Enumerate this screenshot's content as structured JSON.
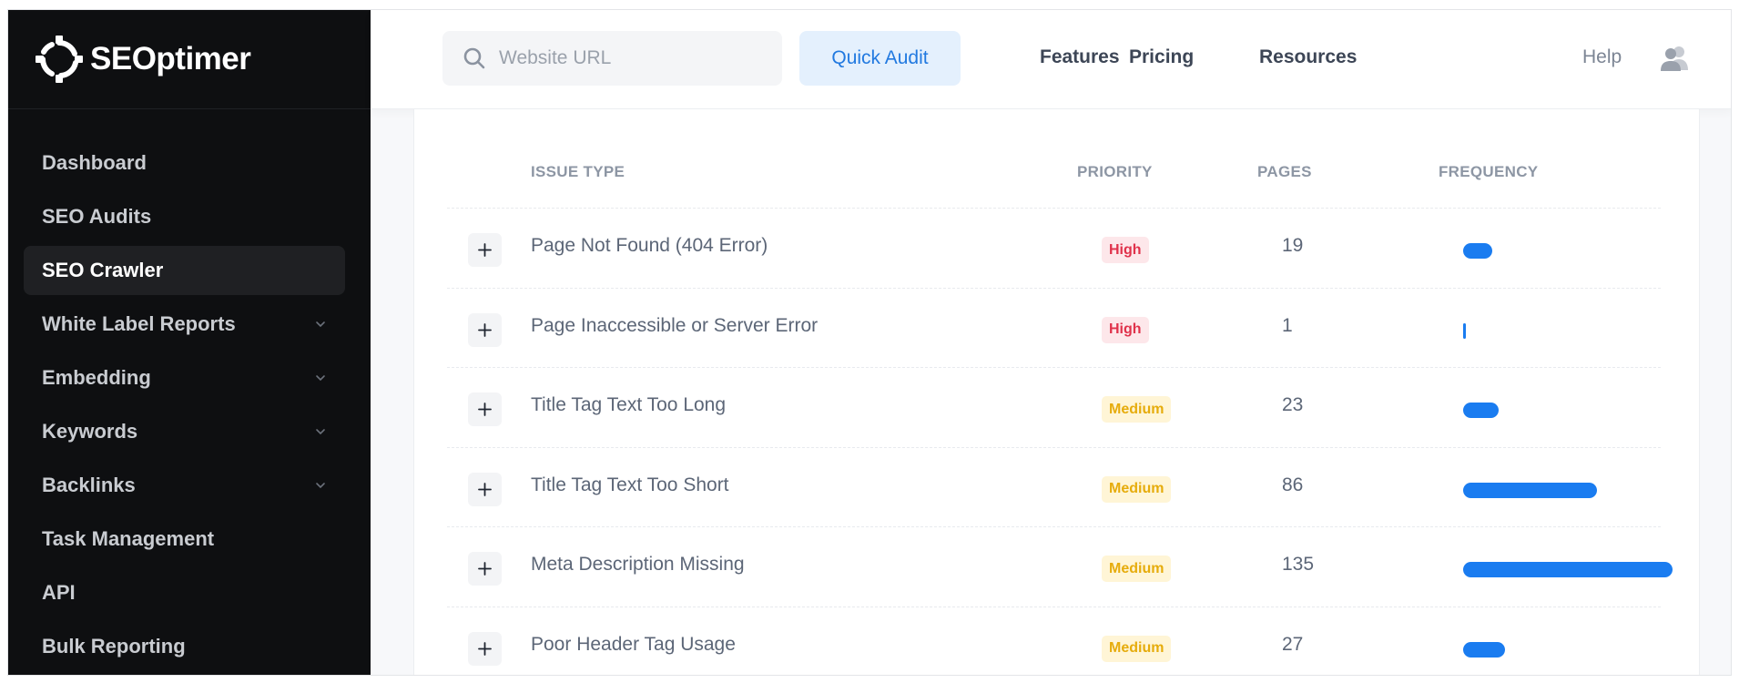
{
  "brand": {
    "name": "SEOptimer"
  },
  "sidebar": {
    "items": [
      {
        "label": "Dashboard",
        "name": "sidebar-item-dashboard",
        "active": false,
        "expandable": false
      },
      {
        "label": "SEO Audits",
        "name": "sidebar-item-seo-audits",
        "active": false,
        "expandable": false
      },
      {
        "label": "SEO Crawler",
        "name": "sidebar-item-seo-crawler",
        "active": true,
        "expandable": false
      },
      {
        "label": "White Label Reports",
        "name": "sidebar-item-white-label-reports",
        "active": false,
        "expandable": true
      },
      {
        "label": "Embedding",
        "name": "sidebar-item-embedding",
        "active": false,
        "expandable": true
      },
      {
        "label": "Keywords",
        "name": "sidebar-item-keywords",
        "active": false,
        "expandable": true
      },
      {
        "label": "Backlinks",
        "name": "sidebar-item-backlinks",
        "active": false,
        "expandable": true
      },
      {
        "label": "Task Management",
        "name": "sidebar-item-task-management",
        "active": false,
        "expandable": false
      },
      {
        "label": "API",
        "name": "sidebar-item-api",
        "active": false,
        "expandable": false
      },
      {
        "label": "Bulk Reporting",
        "name": "sidebar-item-bulk-reporting",
        "active": false,
        "expandable": false
      }
    ]
  },
  "topbar": {
    "search_placeholder": "Website URL",
    "quick_audit_label": "Quick Audit",
    "nav": [
      {
        "label": "Features",
        "name": "nav-features"
      },
      {
        "label": "Pricing",
        "name": "nav-pricing"
      },
      {
        "label": "Resources",
        "name": "nav-resources"
      }
    ],
    "help_label": "Help"
  },
  "table": {
    "headers": {
      "issue_type": "ISSUE TYPE",
      "priority": "PRIORITY",
      "pages": "PAGES",
      "frequency": "FREQUENCY"
    },
    "rows": [
      {
        "issue": "Page Not Found (404 Error)",
        "priority": "High",
        "pages": "19",
        "frequency": 0.14
      },
      {
        "issue": "Page Inaccessible or Server Error",
        "priority": "High",
        "pages": "1",
        "frequency": 0.01
      },
      {
        "issue": "Title Tag Text Too Long",
        "priority": "Medium",
        "pages": "23",
        "frequency": 0.17
      },
      {
        "issue": "Title Tag Text Too Short",
        "priority": "Medium",
        "pages": "86",
        "frequency": 0.64
      },
      {
        "issue": "Meta Description Missing",
        "priority": "Medium",
        "pages": "135",
        "frequency": 1.0
      },
      {
        "issue": "Poor Header Tag Usage",
        "priority": "Medium",
        "pages": "27",
        "frequency": 0.2
      }
    ]
  },
  "colors": {
    "sidebar_bg": "#0e0f11",
    "accent_blue": "#1a7cf0",
    "high_text": "#e0324b",
    "high_bg": "#fde7ea",
    "medium_text": "#e6ac0c",
    "medium_bg": "#fff5d6"
  },
  "icons": {
    "logo": "seoptimer-gear-logo-icon",
    "search": "search-icon",
    "user": "user-group-icon",
    "expand": "plus-icon",
    "chevron": "chevron-down-icon"
  }
}
